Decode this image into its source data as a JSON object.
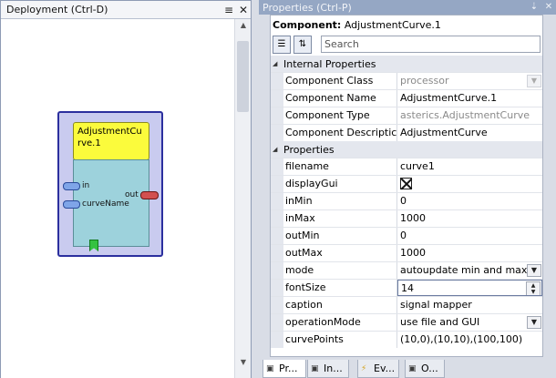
{
  "deployment": {
    "title": "Deployment (Ctrl-D)",
    "component": {
      "name": "AdjustmentCurve.1",
      "input_ports": [
        "in",
        "curveName"
      ],
      "output_ports": [
        "out"
      ]
    }
  },
  "properties": {
    "title": "Properties (Ctrl-P)",
    "component_label": "Component:",
    "component_value": "AdjustmentCurve.1",
    "search_placeholder": "Search",
    "categories": [
      {
        "name": "Internal Properties",
        "rows": [
          {
            "name": "Component Class",
            "value": "processor"
          },
          {
            "name": "Component Name",
            "value": "AdjustmentCurve.1"
          },
          {
            "name": "Component Type",
            "value": "asterics.AdjustmentCurve"
          },
          {
            "name": "Component Descriptic",
            "value": "AdjustmentCurve"
          }
        ]
      },
      {
        "name": "Properties",
        "rows": [
          {
            "name": "filename",
            "value": "curve1"
          },
          {
            "name": "displayGui",
            "value": ""
          },
          {
            "name": "inMin",
            "value": "0"
          },
          {
            "name": "inMax",
            "value": "1000"
          },
          {
            "name": "outMin",
            "value": "0"
          },
          {
            "name": "outMax",
            "value": "1000"
          },
          {
            "name": "mode",
            "value": "autoupdate min and max"
          },
          {
            "name": "fontSize",
            "value": "14"
          },
          {
            "name": "caption",
            "value": "signal mapper"
          },
          {
            "name": "operationMode",
            "value": "use file and GUI"
          },
          {
            "name": "curvePoints",
            "value": "(10,0),(10,10),(100,100)"
          }
        ]
      }
    ]
  },
  "bottom_tabs": [
    {
      "label": "Pr..."
    },
    {
      "label": "In..."
    },
    {
      "label": "Ev..."
    },
    {
      "label": "O..."
    }
  ]
}
